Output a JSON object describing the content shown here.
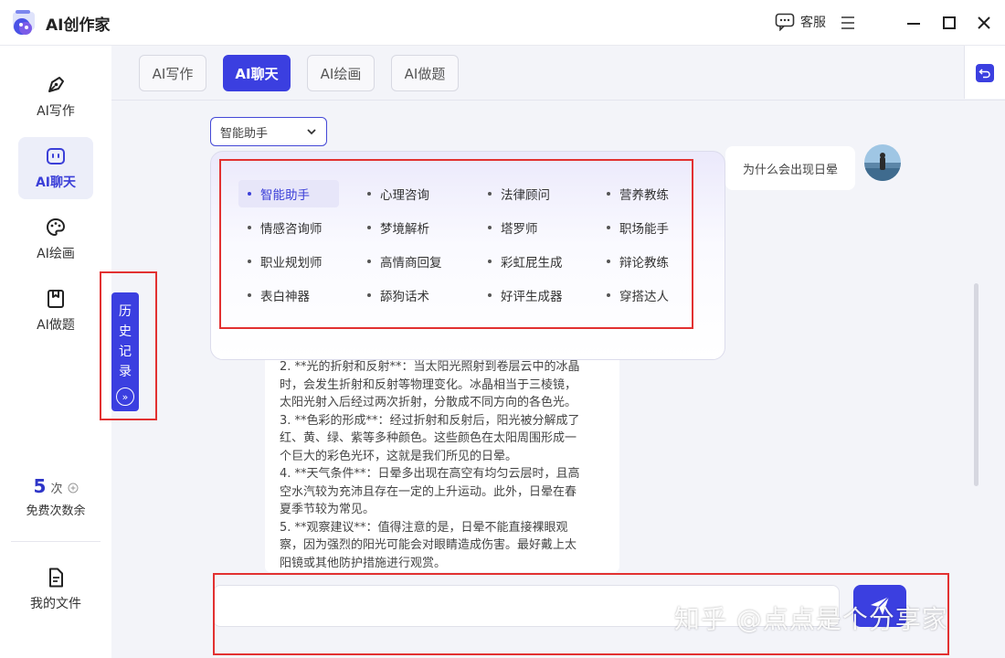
{
  "app": {
    "title": "AI创作家"
  },
  "titlebar": {
    "service_label": "客服"
  },
  "sidebar": {
    "items": [
      {
        "label": "AI写作",
        "icon": "pen-icon"
      },
      {
        "label": "AI聊天",
        "icon": "chat-bot-icon",
        "active": true
      },
      {
        "label": "AI绘画",
        "icon": "palette-icon"
      },
      {
        "label": "AI做题",
        "icon": "exam-icon"
      }
    ],
    "quota": {
      "count": "5",
      "unit": "次",
      "label": "免费次数余"
    },
    "my_files": "我的文件"
  },
  "tabs": [
    {
      "label": "AI写作"
    },
    {
      "label": "AI聊天",
      "active": true
    },
    {
      "label": "AI绘画"
    },
    {
      "label": "AI做题"
    }
  ],
  "assistant_select": {
    "value": "智能助手"
  },
  "assistants": [
    "智能助手",
    "心理咨询",
    "法律顾问",
    "营养教练",
    "情感咨询师",
    "梦境解析",
    "塔罗师",
    "职场能手",
    "职业规划师",
    "高情商回复",
    "彩虹屁生成",
    "辩论教练",
    "表白神器",
    "舔狗话术",
    "好评生成器",
    "穿搭达人"
  ],
  "chat": {
    "user_message": "为什么会出现日晕",
    "answer_lines": [
      "2. **光的折射和反射**：当太阳光照射到卷层云中的冰晶",
      "时，会发生折射和反射等物理变化。冰晶相当于三棱镜，",
      "太阳光射入后经过两次折射，分散成不同方向的各色光。",
      "3. **色彩的形成**：经过折射和反射后，阳光被分解成了",
      "红、黄、绿、紫等多种颜色。这些颜色在太阳周围形成一",
      "个巨大的彩色光环，这就是我们所见的日晕。",
      "4. **天气条件**：日晕多出现在高空有均匀云层时，且高",
      "空水汽较为充沛且存在一定的上升运动。此外，日晕在春",
      "夏季节较为常见。",
      "5. **观察建议**：值得注意的是，日晕不能直接裸眼观",
      "察，因为强烈的阳光可能会对眼睛造成伤害。最好戴上太",
      "阳镜或其他防护措施进行观赏。"
    ]
  },
  "history": {
    "label_chars": [
      "历",
      "史",
      "记",
      "录"
    ]
  },
  "input": {
    "value": ""
  },
  "watermark": "知乎 @点点是个分享家",
  "colors": {
    "accent": "#3b3fe0",
    "highlight": "#e23131",
    "background": "#f3f4f9"
  }
}
